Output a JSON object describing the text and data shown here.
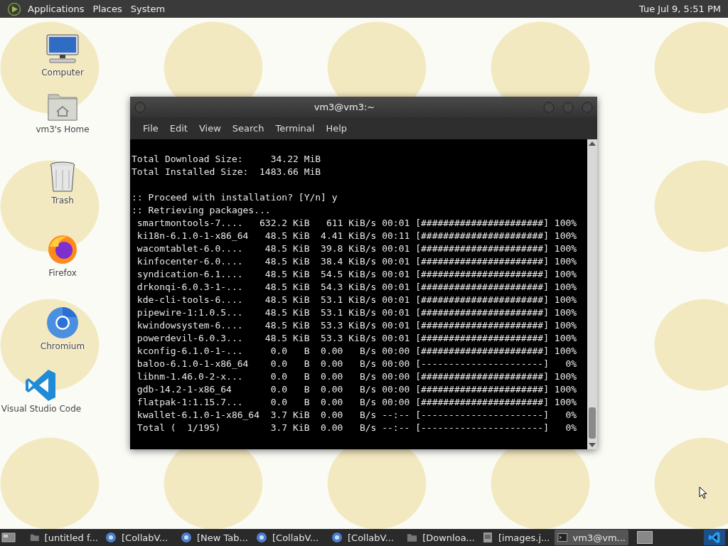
{
  "top_panel": {
    "menus": [
      "Applications",
      "Places",
      "System"
    ],
    "clock": "Tue Jul  9,  5:51 PM"
  },
  "desktop_icons": [
    {
      "label": "Computer",
      "kind": "computer"
    },
    {
      "label": "vm3's Home",
      "kind": "home"
    },
    {
      "label": "Trash",
      "kind": "trash"
    },
    {
      "label": "Firefox",
      "kind": "firefox"
    },
    {
      "label": "Chromium",
      "kind": "chromium"
    },
    {
      "label": "Visual Studio Code",
      "kind": "vscode"
    }
  ],
  "terminal": {
    "title": "vm3@vm3:~",
    "menu": [
      "File",
      "Edit",
      "View",
      "Search",
      "Terminal",
      "Help"
    ],
    "blocks": [
      [
        "Total Download Size:     34.22 MiB",
        "Total Installed Size:  1483.66 MiB"
      ],
      [
        ":: Proceed with installation? [Y/n] y",
        ":: Retrieving packages...",
        " smartmontools-7....   632.2 KiB   611 KiB/s 00:01 [######################] 100%",
        " ki18n-6.1.0-1-x86_64   48.5 KiB  4.41 KiB/s 00:11 [######################] 100%",
        " wacomtablet-6.0....    48.5 KiB  39.8 KiB/s 00:01 [######################] 100%",
        " kinfocenter-6.0....    48.5 KiB  38.4 KiB/s 00:01 [######################] 100%",
        " syndication-6.1....    48.5 KiB  54.5 KiB/s 00:01 [######################] 100%",
        " drkonqi-6.0.3-1-...    48.5 KiB  54.3 KiB/s 00:01 [######################] 100%",
        " kde-cli-tools-6....    48.5 KiB  53.1 KiB/s 00:01 [######################] 100%",
        " pipewire-1:1.0.5...    48.5 KiB  53.1 KiB/s 00:01 [######################] 100%",
        " kwindowsystem-6....    48.5 KiB  53.3 KiB/s 00:01 [######################] 100%",
        " powerdevil-6.0.3...    48.5 KiB  53.3 KiB/s 00:01 [######################] 100%",
        " kconfig-6.1.0-1-...     0.0   B  0.00   B/s 00:00 [######################] 100%",
        " baloo-6.1.0-1-x86_64    0.0   B  0.00   B/s 00:00 [----------------------]   0%",
        " libnm-1.46.0-2-x...     0.0   B  0.00   B/s 00:00 [######################] 100%",
        " gdb-14.2-1-x86_64       0.0   B  0.00   B/s 00:00 [######################] 100%",
        " flatpak-1:1.15.7...     0.0   B  0.00   B/s 00:00 [######################] 100%",
        " kwallet-6.1.0-1-x86_64  3.7 KiB  0.00   B/s --:-- [----------------------]   0%",
        " Total (  1/195)         3.7 KiB  0.00   B/s --:-- [----------------------]   0%"
      ]
    ]
  },
  "taskbar": {
    "items": [
      {
        "label": "[untitled f...",
        "kind": "folder",
        "selected": false
      },
      {
        "label": "[CollabV...",
        "kind": "browser",
        "selected": false
      },
      {
        "label": "[New Tab...",
        "kind": "browser",
        "selected": false
      },
      {
        "label": "[CollabV...",
        "kind": "browser",
        "selected": false
      },
      {
        "label": "[CollabV...",
        "kind": "browser",
        "selected": false
      },
      {
        "label": "[Downloa...",
        "kind": "folder",
        "selected": false
      },
      {
        "label": "[images.j...",
        "kind": "image",
        "selected": false
      },
      {
        "label": "vm3@vm...",
        "kind": "terminal",
        "selected": true
      }
    ]
  }
}
